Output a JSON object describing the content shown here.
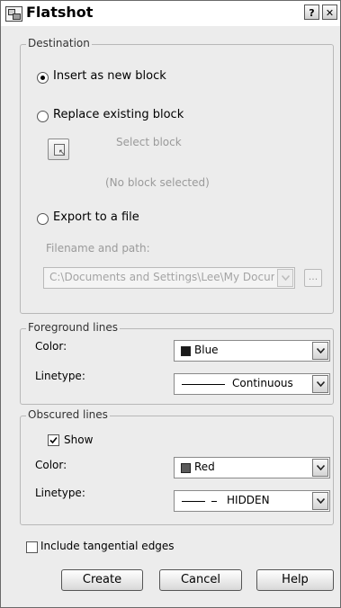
{
  "window": {
    "title": "Flatshot",
    "help_glyph": "?",
    "close_glyph": "✕"
  },
  "destination": {
    "legend": "Destination",
    "insert_label": "Insert as new block",
    "insert_selected": true,
    "replace_label": "Replace existing block",
    "replace_selected": false,
    "select_block_label": "Select block",
    "no_block_selected": "(No block selected)",
    "export_label": "Export to a file",
    "export_selected": false,
    "filename_label": "Filename and path:",
    "filename_value": "C:\\Documents and Settings\\Lee\\My Docum",
    "browse_label": "..."
  },
  "foreground": {
    "legend": "Foreground lines",
    "color_label": "Color:",
    "color_value": "Blue",
    "color_swatch": "#1a1a1a",
    "linetype_label": "Linetype:",
    "linetype_value": "Continuous"
  },
  "obscured": {
    "legend": "Obscured lines",
    "show_label": "Show",
    "show_checked": true,
    "color_label": "Color:",
    "color_value": "Red",
    "color_swatch": "#5a5a5a",
    "linetype_label": "Linetype:",
    "linetype_value": "HIDDEN"
  },
  "tangential": {
    "label": "Include tangential edges",
    "checked": false
  },
  "buttons": {
    "create": "Create",
    "cancel": "Cancel",
    "help": "Help"
  }
}
